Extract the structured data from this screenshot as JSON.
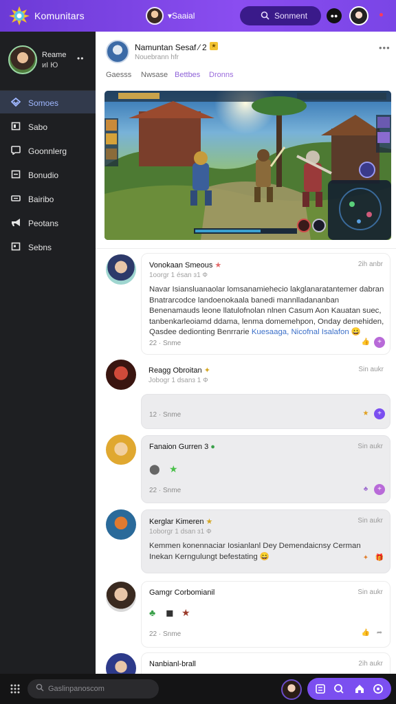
{
  "topbar": {
    "app_title": "Komunitars",
    "channel": "Saaial",
    "search_label": "Sonment",
    "dark_toggle": "dark"
  },
  "sidebar": {
    "profile_name": "Reame",
    "profile_sub": "иI Ю",
    "items": [
      {
        "label": "Somoes",
        "icon": "diamond-icon",
        "active": true
      },
      {
        "label": "Sabo",
        "icon": "square-icon"
      },
      {
        "label": "Goonnlerg",
        "icon": "chat-icon"
      },
      {
        "label": "Bonudio",
        "icon": "box-icon"
      },
      {
        "label": "Bairibo",
        "icon": "ticket-icon"
      },
      {
        "label": "Peotans",
        "icon": "megaphone-icon"
      },
      {
        "label": "Sebns",
        "icon": "settings-square-icon"
      }
    ]
  },
  "header": {
    "title": "Namuntan Sesaf ⁄ 2",
    "subtitle": "Nouebrann hfr",
    "tabs": [
      "Gaesss",
      "Nwsase",
      "Bettbes",
      "Dronns"
    ]
  },
  "posts": [
    {
      "name": "Vonokaan Smeous",
      "time": "2ih anbr",
      "meta": "1oorgr 1 ésan ɜ1 Ф",
      "body": "Navar Isiansluanaolar lomsanamiehecio lakglanaratantemer dabran Bnatrarcodce landoenokaala banedi mannlladananban Benenamauds leone llatulofnolan nlnen Casum Aon Kauatan suec, tanbenkarleoiamd ddama, lenma domemehpon, Onday demehiden, Qasdee dedionting Benrrarie",
      "links": "Kuesaaga, Nicofnal Isalafon",
      "foot": "22 · Snme"
    },
    {
      "name": "Reagg Obroitan",
      "time": "Sin aukr",
      "meta": "Jobogr 1 dsanɜ 1 Ф"
    },
    {
      "foot": "12 · Snme"
    },
    {
      "name": "Fanaion Gurren 3",
      "time": "Sin aukr",
      "foot": "22 · Snme"
    },
    {
      "name": "Kerglar Kimeren",
      "time": "Sin aukr",
      "meta": "1oborgr 1 dsan ɜ1 Ф",
      "body": "Kemmen konennaciar Iosianlanl Dey Demendaicnsy Cerman Inekan Kerngulungt befestating"
    },
    {
      "name": "Gamgr Corbomianil",
      "time": "Sin aukr",
      "foot": "22 · Snme"
    },
    {
      "name": "Nanbianl-brall",
      "time": "2ih aukr"
    }
  ],
  "bottombar": {
    "search_placeholder": "Gaslinpanoscom"
  },
  "colors": {
    "accent": "#7b4ff0",
    "sidebar_bg": "#1e1f22",
    "active_nav": "#323a4c"
  }
}
